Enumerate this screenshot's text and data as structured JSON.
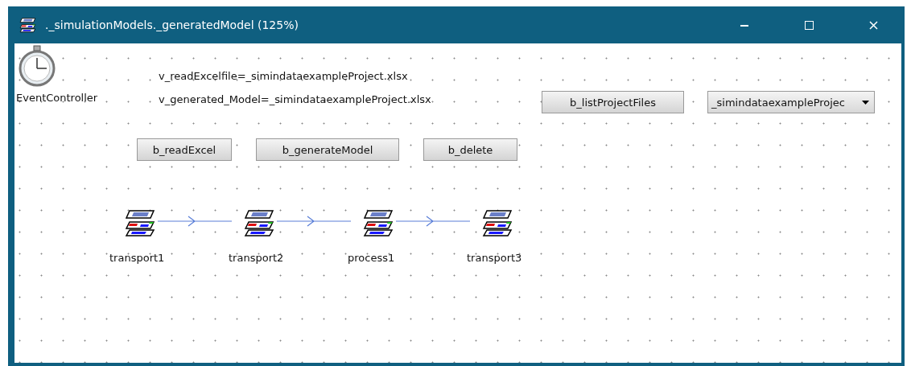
{
  "window": {
    "title": "._simulationModels._generatedModel  (125%)"
  },
  "event_controller": {
    "label": "EventController"
  },
  "variables": [
    "v_readExcelfile=_simindataexampleProject.xlsx",
    "v_generated_Model=_simindataexampleProject.xlsx"
  ],
  "top_button": "b_listProjectFiles",
  "dropdown": {
    "value": "_simindataexampleProjec"
  },
  "buttons": [
    "b_readExcel",
    "b_generateModel",
    "b_delete"
  ],
  "nodes": [
    {
      "label": "transport1"
    },
    {
      "label": "transport2"
    },
    {
      "label": "process1"
    },
    {
      "label": "transport3"
    }
  ]
}
